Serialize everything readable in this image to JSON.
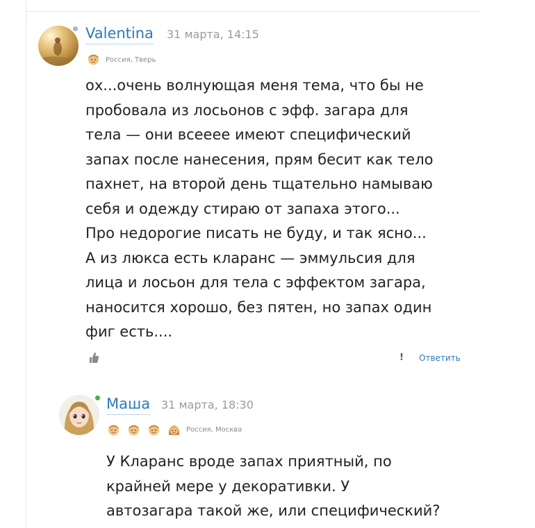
{
  "comments": [
    {
      "username": "Valentina",
      "timestamp": "31 марта, 14:15",
      "location": "Россия, Тверь",
      "online_status_color": "#aab4c4",
      "text_lines": [
        "ох...очень волнующая меня тема, что бы не",
        "пробовала из лосьонов с эфф. загара для",
        "тела — они всееее имеют специфический",
        "запах после нанесения, прям бесит как тело",
        "пахнет, на второй день тщательно намываю",
        "себя и одежду стираю от запаха этого...",
        "Про недорогие писать не буду, и так ясно...",
        "А из люкса есть кларанс — эммульсия для",
        "лица и лосьон для тела с эффектом загара,",
        "наносится хорошо, без пятен, но запах один",
        "фиг есть...."
      ],
      "actions": {
        "report_label": "!",
        "reply_label": "Ответить"
      }
    },
    {
      "username": "Маша",
      "timestamp": "31 марта, 18:30",
      "location": "Россия, Москва",
      "online_status_color": "#3cb44a",
      "text_lines": [
        "У Кларанс вроде запах приятный, по",
        "крайней мере у декоративки. У",
        "автозагара такой же, или специфический?"
      ]
    }
  ],
  "icons": [
    "face-badge-icon",
    "thumbs-up-icon"
  ],
  "colors": {
    "link": "#2a7ab9",
    "muted": "#9a9a9a",
    "text": "#222222"
  }
}
